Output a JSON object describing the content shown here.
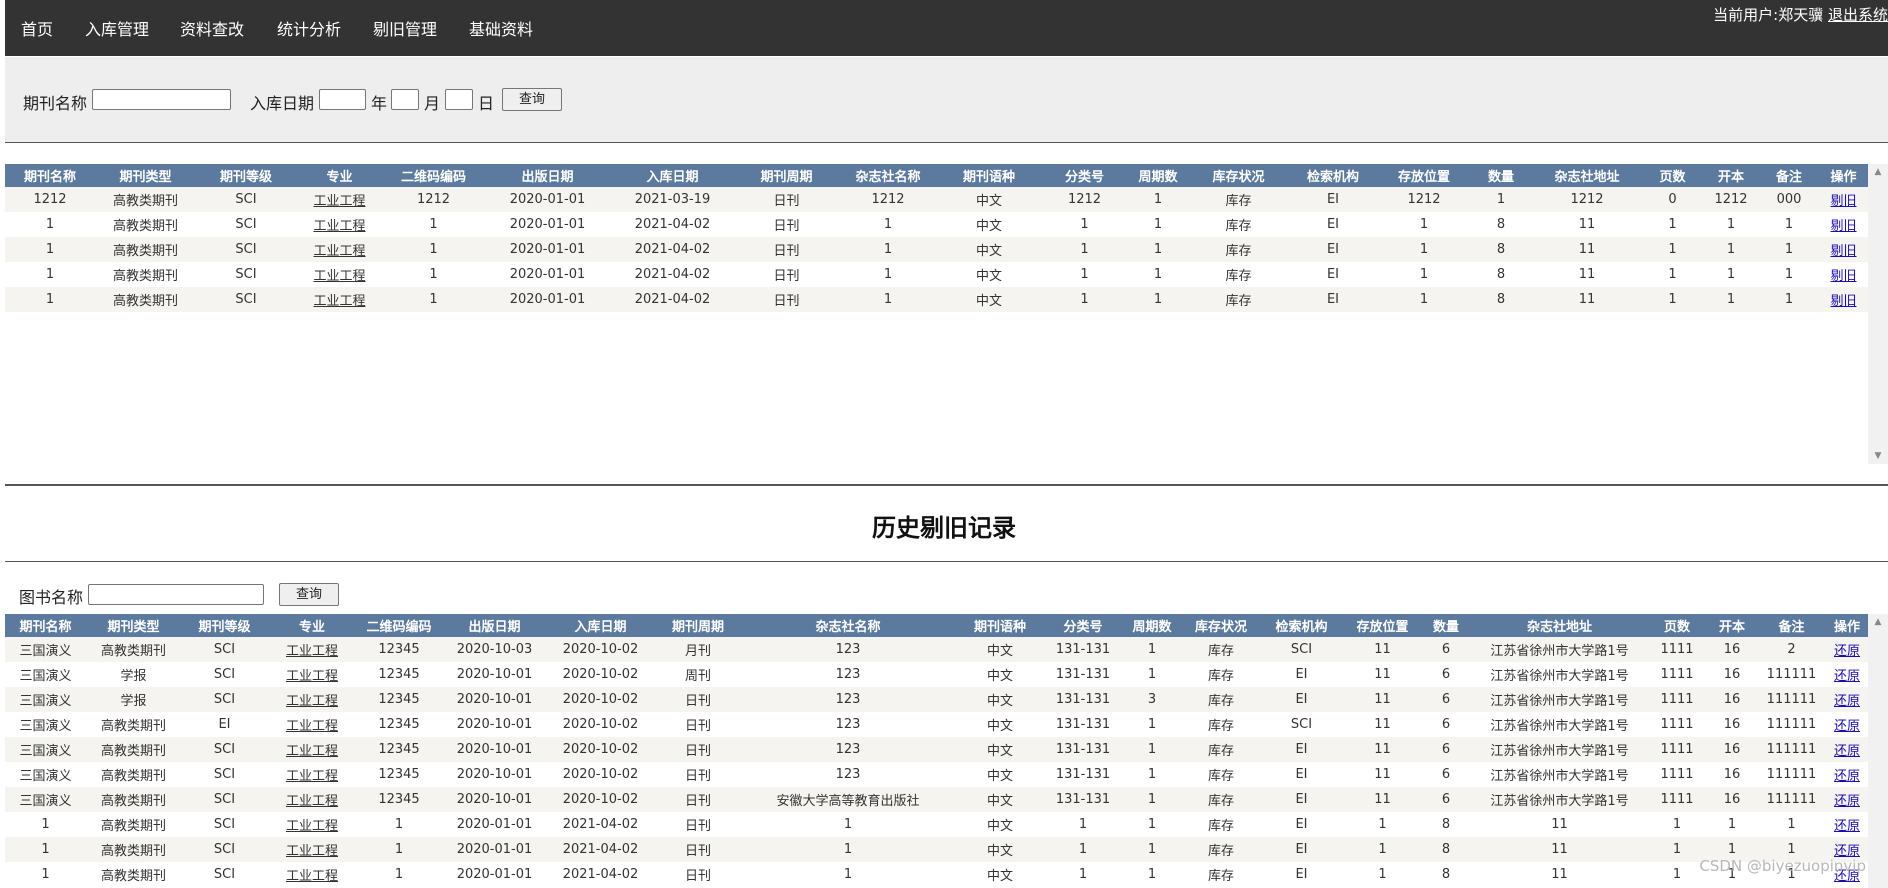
{
  "nav": {
    "items": [
      {
        "label": "首页"
      },
      {
        "label": "入库管理"
      },
      {
        "label": "资料查改"
      },
      {
        "label": "统计分析"
      },
      {
        "label": "剔旧管理"
      },
      {
        "label": "基础资料"
      }
    ],
    "user_text": "当前用户:郑天骥",
    "logout_label": "退出系统"
  },
  "search": {
    "name_label": "期刊名称",
    "name_value": "",
    "date_label": "入库日期",
    "year_suffix": "年",
    "month_suffix": "月",
    "day_suffix": "日",
    "query_label": "查询"
  },
  "inventory": {
    "columns": [
      "期刊名称",
      "期刊类型",
      "期刊等级",
      "专业",
      "二维码编码",
      "出版日期",
      "入库日期",
      "期刊周期",
      "杂志社名称",
      "期刊语种",
      "分类号",
      "周期数",
      "库存状况",
      "检索机构",
      "存放位置",
      "数量",
      "杂志社地址",
      "页数",
      "开本",
      "备注",
      "操作"
    ],
    "rows": [
      [
        "1212",
        "高教类期刊",
        "SCI",
        "工业工程",
        "1212",
        "2020-01-01",
        "2021-03-19",
        "日刊",
        "1212",
        "中文",
        "1212",
        "1",
        "库存",
        "EI",
        "1212",
        "1",
        "1212",
        "0",
        "1212",
        "000",
        "剔旧"
      ],
      [
        "1",
        "高教类期刊",
        "SCI",
        "工业工程",
        "1",
        "2020-01-01",
        "2021-04-02",
        "日刊",
        "1",
        "中文",
        "1",
        "1",
        "库存",
        "EI",
        "1",
        "8",
        "11",
        "1",
        "1",
        "1",
        "剔旧"
      ],
      [
        "1",
        "高教类期刊",
        "SCI",
        "工业工程",
        "1",
        "2020-01-01",
        "2021-04-02",
        "日刊",
        "1",
        "中文",
        "1",
        "1",
        "库存",
        "EI",
        "1",
        "8",
        "11",
        "1",
        "1",
        "1",
        "剔旧"
      ],
      [
        "1",
        "高教类期刊",
        "SCI",
        "工业工程",
        "1",
        "2020-01-01",
        "2021-04-02",
        "日刊",
        "1",
        "中文",
        "1",
        "1",
        "库存",
        "EI",
        "1",
        "8",
        "11",
        "1",
        "1",
        "1",
        "剔旧"
      ],
      [
        "1",
        "高教类期刊",
        "SCI",
        "工业工程",
        "1",
        "2020-01-01",
        "2021-04-02",
        "日刊",
        "1",
        "中文",
        "1",
        "1",
        "库存",
        "EI",
        "1",
        "8",
        "11",
        "1",
        "1",
        "1",
        "剔旧"
      ]
    ]
  },
  "history": {
    "title": "历史剔旧记录",
    "search_label": "图书名称",
    "search_value": "",
    "query_label": "查询",
    "columns": [
      "期刊名称",
      "期刊类型",
      "期刊等级",
      "专业",
      "二维码编码",
      "出版日期",
      "入库日期",
      "期刊周期",
      "杂志社名称",
      "期刊语种",
      "分类号",
      "周期数",
      "库存状况",
      "检索机构",
      "存放位置",
      "数量",
      "杂志社地址",
      "页数",
      "开本",
      "备注",
      "操作"
    ],
    "rows": [
      [
        "三国演义",
        "高教类期刊",
        "SCI",
        "工业工程",
        "12345",
        "2020-10-03",
        "2020-10-02",
        "月刊",
        "123",
        "中文",
        "131-131",
        "1",
        "库存",
        "SCI",
        "11",
        "6",
        "江苏省徐州市大学路1号",
        "1111",
        "16",
        "2",
        "还原"
      ],
      [
        "三国演义",
        "学报",
        "SCI",
        "工业工程",
        "12345",
        "2020-10-01",
        "2020-10-02",
        "周刊",
        "123",
        "中文",
        "131-131",
        "1",
        "库存",
        "EI",
        "11",
        "6",
        "江苏省徐州市大学路1号",
        "1111",
        "16",
        "111111",
        "还原"
      ],
      [
        "三国演义",
        "学报",
        "SCI",
        "工业工程",
        "12345",
        "2020-10-01",
        "2020-10-02",
        "日刊",
        "123",
        "中文",
        "131-131",
        "3",
        "库存",
        "EI",
        "11",
        "6",
        "江苏省徐州市大学路1号",
        "1111",
        "16",
        "111111",
        "还原"
      ],
      [
        "三国演义",
        "高教类期刊",
        "EI",
        "工业工程",
        "12345",
        "2020-10-01",
        "2020-10-02",
        "日刊",
        "123",
        "中文",
        "131-131",
        "1",
        "库存",
        "SCI",
        "11",
        "6",
        "江苏省徐州市大学路1号",
        "1111",
        "16",
        "111111",
        "还原"
      ],
      [
        "三国演义",
        "高教类期刊",
        "SCI",
        "工业工程",
        "12345",
        "2020-10-01",
        "2020-10-02",
        "日刊",
        "123",
        "中文",
        "131-131",
        "1",
        "库存",
        "EI",
        "11",
        "6",
        "江苏省徐州市大学路1号",
        "1111",
        "16",
        "111111",
        "还原"
      ],
      [
        "三国演义",
        "高教类期刊",
        "SCI",
        "工业工程",
        "12345",
        "2020-10-01",
        "2020-10-02",
        "日刊",
        "123",
        "中文",
        "131-131",
        "1",
        "库存",
        "EI",
        "11",
        "6",
        "江苏省徐州市大学路1号",
        "1111",
        "16",
        "111111",
        "还原"
      ],
      [
        "三国演义",
        "高教类期刊",
        "SCI",
        "工业工程",
        "12345",
        "2020-10-01",
        "2020-10-02",
        "日刊",
        "安徽大学高等教育出版社",
        "中文",
        "131-131",
        "1",
        "库存",
        "EI",
        "11",
        "6",
        "江苏省徐州市大学路1号",
        "1111",
        "16",
        "111111",
        "还原"
      ],
      [
        "1",
        "高教类期刊",
        "SCI",
        "工业工程",
        "1",
        "2020-01-01",
        "2021-04-02",
        "日刊",
        "1",
        "中文",
        "1",
        "1",
        "库存",
        "EI",
        "1",
        "8",
        "11",
        "1",
        "1",
        "1",
        "还原"
      ],
      [
        "1",
        "高教类期刊",
        "SCI",
        "工业工程",
        "1",
        "2020-01-01",
        "2021-04-02",
        "日刊",
        "1",
        "中文",
        "1",
        "1",
        "库存",
        "EI",
        "1",
        "8",
        "11",
        "1",
        "1",
        "1",
        "还原"
      ],
      [
        "1",
        "高教类期刊",
        "SCI",
        "工业工程",
        "1",
        "2020-01-01",
        "2021-04-02",
        "日刊",
        "1",
        "中文",
        "1",
        "1",
        "库存",
        "EI",
        "1",
        "8",
        "11",
        "1",
        "1",
        "1",
        "还原"
      ]
    ]
  },
  "watermark": "CSDN @biyezuopinvip"
}
